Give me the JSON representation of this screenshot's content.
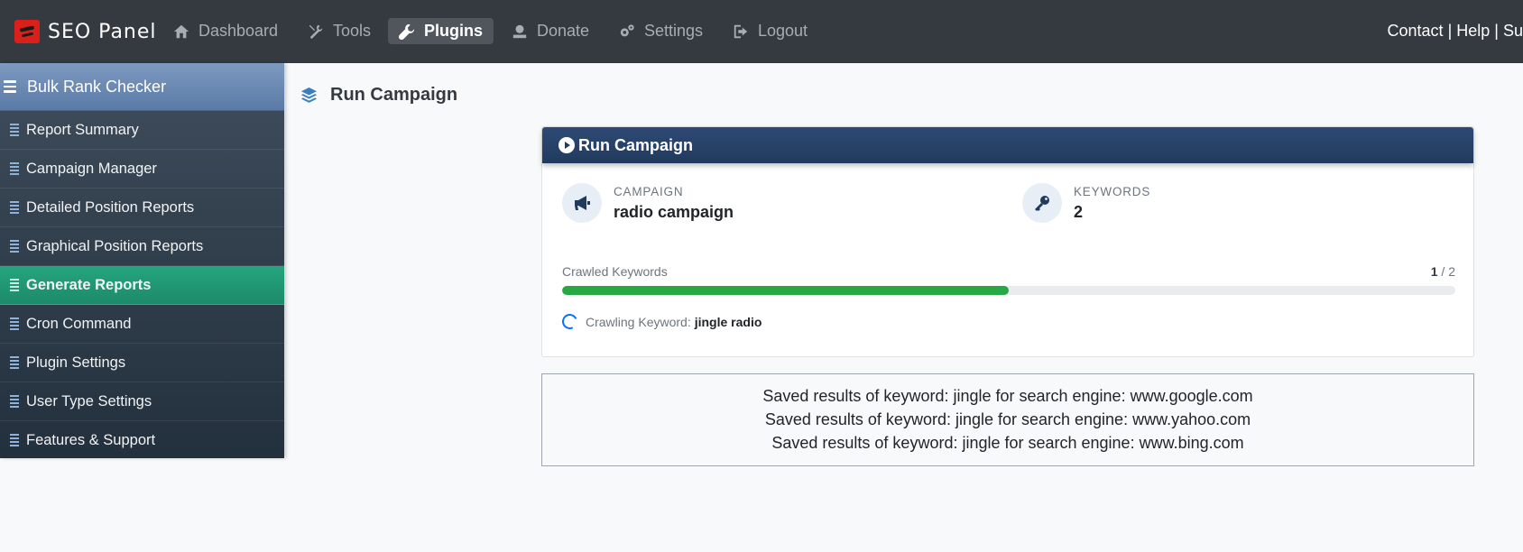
{
  "brand": {
    "name": "SEO Panel"
  },
  "nav": {
    "items": [
      {
        "label": "Dashboard",
        "icon": "home-icon"
      },
      {
        "label": "Tools",
        "icon": "tools-icon"
      },
      {
        "label": "Plugins",
        "icon": "wrench-icon",
        "active": true
      },
      {
        "label": "Donate",
        "icon": "donate-icon"
      },
      {
        "label": "Settings",
        "icon": "gears-icon"
      },
      {
        "label": "Logout",
        "icon": "logout-icon"
      }
    ],
    "right": {
      "contact": "Contact",
      "sep1": " | ",
      "help": "Help",
      "sep2": " | ",
      "support": "Sup"
    }
  },
  "sidebar": {
    "header": "Bulk Rank Checker",
    "items": [
      {
        "label": "Report Summary"
      },
      {
        "label": "Campaign Manager"
      },
      {
        "label": "Detailed Position Reports"
      },
      {
        "label": "Graphical Position Reports"
      },
      {
        "label": "Generate Reports",
        "active": true
      },
      {
        "label": "Cron Command"
      },
      {
        "label": "Plugin Settings"
      },
      {
        "label": "User Type Settings"
      },
      {
        "label": "Features & Support"
      }
    ]
  },
  "page": {
    "title": "Run Campaign"
  },
  "card": {
    "title": "Run Campaign",
    "campaign": {
      "label": "CAMPAIGN",
      "value": "radio campaign"
    },
    "keywords": {
      "label": "KEYWORDS",
      "value": "2"
    },
    "progress": {
      "label": "Crawled Keywords",
      "done": "1",
      "sep": " / ",
      "total": "2",
      "fraction": 0.5
    },
    "crawling": {
      "label": "Crawling Keyword:",
      "keyword": "jingle radio"
    }
  },
  "results": [
    "Saved results of keyword: jingle for search engine: www.google.com",
    "Saved results of keyword: jingle for search engine: www.yahoo.com",
    "Saved results of keyword: jingle for search engine: www.bing.com"
  ],
  "colors": {
    "navbar": "#343a40",
    "active_sidebar": "#1d8a69",
    "card_header": "#213a5e",
    "progress": "#28a745"
  }
}
